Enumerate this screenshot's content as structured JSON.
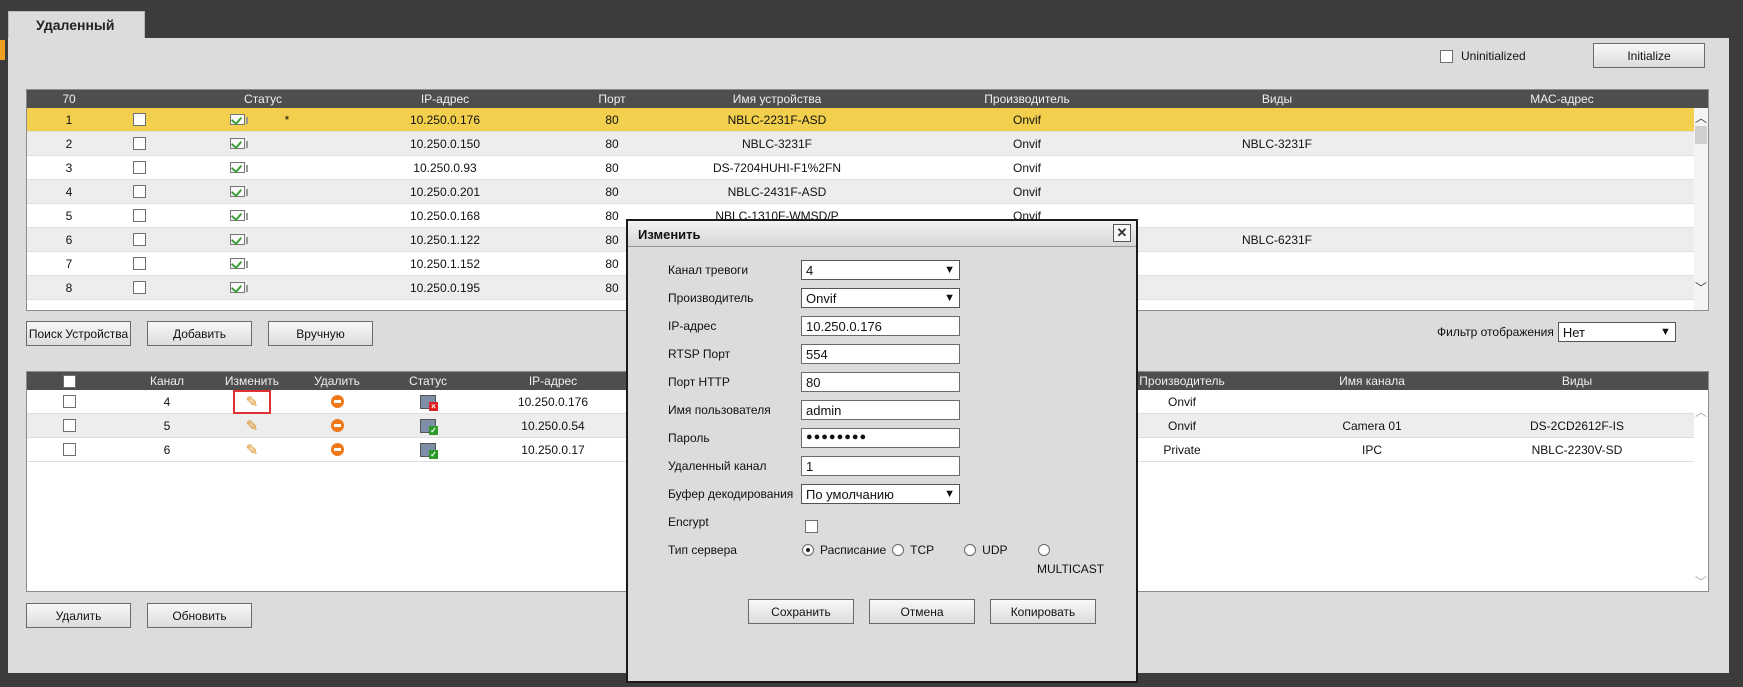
{
  "tab": {
    "title": "Удаленный"
  },
  "uninitialized_label": "Uninitialized",
  "initialize_label": "Initialize",
  "device_list": {
    "headers": {
      "count": "70",
      "status": "Статус",
      "ip": "IP-адрес",
      "port": "Порт",
      "name": "Имя устройства",
      "vendor": "Производитель",
      "type": "Виды",
      "mac": "МАС-адрес"
    },
    "rows": [
      {
        "num": "1",
        "mark": "*",
        "ip": "10.250.0.176",
        "port": "80",
        "name": "NBLC-2231F-ASD",
        "vendor": "Onvif",
        "type": ""
      },
      {
        "num": "2",
        "mark": "",
        "ip": "10.250.0.150",
        "port": "80",
        "name": "NBLC-3231F",
        "vendor": "Onvif",
        "type": "NBLC-3231F"
      },
      {
        "num": "3",
        "mark": "",
        "ip": "10.250.0.93",
        "port": "80",
        "name": "DS-7204HUHI-F1%2FN",
        "vendor": "Onvif",
        "type": ""
      },
      {
        "num": "4",
        "mark": "",
        "ip": "10.250.0.201",
        "port": "80",
        "name": "NBLC-2431F-ASD",
        "vendor": "Onvif",
        "type": ""
      },
      {
        "num": "5",
        "mark": "",
        "ip": "10.250.0.168",
        "port": "80",
        "name": "NBLC-1310F-WMSD/P",
        "vendor": "Onvif",
        "type": ""
      },
      {
        "num": "6",
        "mark": "",
        "ip": "10.250.1.122",
        "port": "80",
        "name": "",
        "vendor": "",
        "type": "NBLC-6231F"
      },
      {
        "num": "7",
        "mark": "",
        "ip": "10.250.1.152",
        "port": "80",
        "name": "",
        "vendor": "",
        "type": ""
      },
      {
        "num": "8",
        "mark": "",
        "ip": "10.250.0.195",
        "port": "80",
        "name": "",
        "vendor": "",
        "type": ""
      }
    ]
  },
  "buttons": {
    "search": "Поиск Устройства",
    "add": "Добавить",
    "manual": "Вручную",
    "delete": "Удалить",
    "refresh": "Обновить"
  },
  "filter": {
    "label": "Фильтр отображения",
    "value": "Нет"
  },
  "added_list": {
    "headers": {
      "channel": "Канал",
      "edit": "Изменить",
      "delete": "Удалить",
      "status": "Статус",
      "ip": "IP-адрес",
      "vendor": "Производитель",
      "channel_name": "Имя канала",
      "type": "Виды"
    },
    "rows": [
      {
        "channel": "4",
        "ip": "10.250.0.176",
        "vendor": "Onvif",
        "channel_name": "",
        "type": "",
        "status": "error"
      },
      {
        "channel": "5",
        "ip": "10.250.0.54",
        "vendor": "Onvif",
        "channel_name": "Camera 01",
        "type": "DS-2CD2612F-IS",
        "status": "ok"
      },
      {
        "channel": "6",
        "ip": "10.250.0.17",
        "vendor": "Private",
        "channel_name": "IPC",
        "type": "NBLC-2230V-SD",
        "status": "ok"
      }
    ]
  },
  "dialog": {
    "title": "Изменить",
    "labels": {
      "alarm": "Канал тревоги",
      "vendor": "Производитель",
      "ip": "IP-адрес",
      "rtsp": "RTSP Порт",
      "http": "Порт HTTP",
      "user": "Имя пользователя",
      "password": "Пароль",
      "remote": "Удаленный канал",
      "buffer": "Буфер декодирования",
      "encrypt": "Encrypt",
      "server": "Тип сервера"
    },
    "values": {
      "alarm": "4",
      "vendor": "Onvif",
      "ip": "10.250.0.176",
      "rtsp": "554",
      "http": "80",
      "user": "admin",
      "password": "●●●●●●●●",
      "remote": "1",
      "buffer": "По умолчанию"
    },
    "server_options": {
      "schedule": "Расписание",
      "tcp": "TCP",
      "udp": "UDP",
      "multicast": "MULTICAST"
    },
    "buttons": {
      "save": "Сохранить",
      "cancel": "Отмена",
      "copy": "Копировать"
    }
  }
}
